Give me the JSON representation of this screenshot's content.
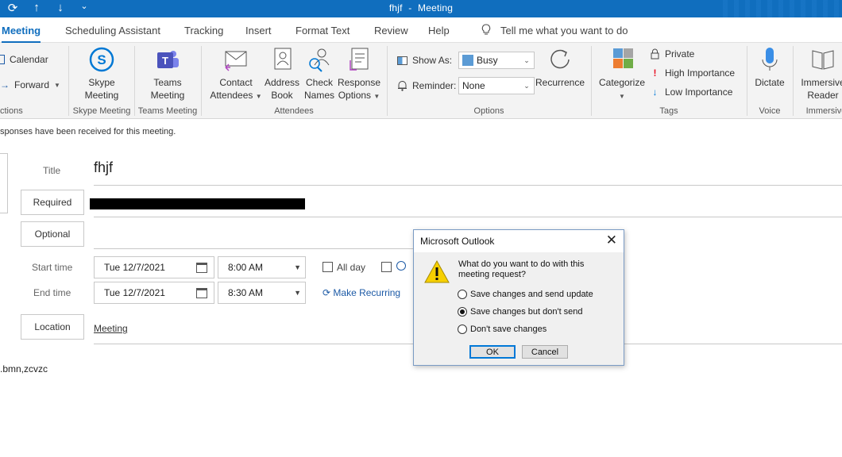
{
  "window": {
    "title": "fhjf",
    "separator": "-",
    "subtitle": "Meeting"
  },
  "tabs": [
    "Meeting",
    "Scheduling Assistant",
    "Tracking",
    "Insert",
    "Format Text",
    "Review",
    "Help"
  ],
  "tell_me": "Tell me what you want to do",
  "ribbon": {
    "actions": {
      "calendar": "Calendar",
      "forward": "Forward",
      "group": "ctions"
    },
    "skype": {
      "line1": "Skype",
      "line2": "Meeting",
      "group": "Skype Meeting"
    },
    "teams": {
      "line1": "Teams",
      "line2": "Meeting",
      "group": "Teams Meeting"
    },
    "attendees": {
      "contact_line1": "Contact",
      "contact_line2": "Attendees",
      "address_line1": "Address",
      "address_line2": "Book",
      "check_line1": "Check",
      "check_line2": "Names",
      "response_line1": "Response",
      "response_line2": "Options",
      "group": "Attendees"
    },
    "options": {
      "show_as_label": "Show As:",
      "show_as_value": "Busy",
      "reminder_label": "Reminder:",
      "reminder_value": "None",
      "recurrence": "Recurrence",
      "group": "Options"
    },
    "tags": {
      "categorize": "Categorize",
      "private": "Private",
      "high_importance": "High Importance",
      "low_importance": "Low Importance",
      "group": "Tags"
    },
    "voice": {
      "dictate": "Dictate",
      "group": "Voice"
    },
    "immersive": {
      "line1": "Immersive",
      "line2": "Reader",
      "group": "Immersive"
    }
  },
  "info_bar": "sponses have been received for this meeting.",
  "form": {
    "title_label": "Title",
    "title_value": "fhjf",
    "required_button": "Required",
    "optional_button": "Optional",
    "start_label": "Start time",
    "start_date": "Tue 12/7/2021",
    "start_time": "8:00 AM",
    "end_label": "End time",
    "end_date": "Tue 12/7/2021",
    "end_time": "8:30 AM",
    "all_day": "All day",
    "make_recurring": "Make Recurring",
    "location_button": "Location",
    "location_value": "Meeting",
    "body_text": ".bmn,zcvzc"
  },
  "dialog": {
    "title": "Microsoft Outlook",
    "question": "What do you want to do with this meeting request?",
    "options": [
      {
        "label": "Save changes and send update",
        "selected": false
      },
      {
        "label": "Save changes but don't send",
        "selected": true
      },
      {
        "label": "Don't save changes",
        "selected": false
      }
    ],
    "ok": "OK",
    "cancel": "Cancel"
  },
  "colors": {
    "accent": "#106ebe",
    "busy_swatch": "#5b9bd5",
    "high_importance": "#e81123",
    "low_importance": "#0078d7",
    "warning": "#f7d000"
  }
}
